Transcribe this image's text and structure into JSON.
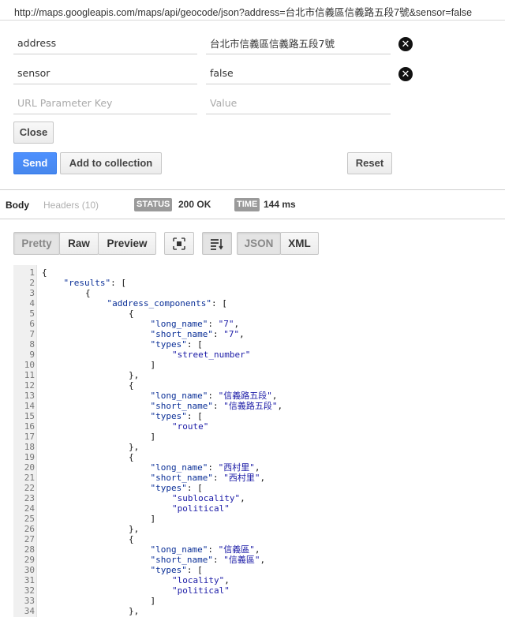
{
  "url": "http://maps.googleapis.com/maps/api/geocode/json?address=台北市信義區信義路五段7號&sensor=false",
  "params": [
    {
      "key": "address",
      "value": "台北市信義區信義路五段7號"
    },
    {
      "key": "sensor",
      "value": "false"
    }
  ],
  "new_param": {
    "key_placeholder": "URL Parameter Key",
    "value_placeholder": "Value"
  },
  "buttons": {
    "close": "Close",
    "send": "Send",
    "add_collection": "Add to collection",
    "reset": "Reset"
  },
  "response_tabs": {
    "body": "Body",
    "headers": "Headers (10)"
  },
  "status": {
    "label": "STATUS",
    "value": "200 OK"
  },
  "time": {
    "label": "TIME",
    "value": "144 ms"
  },
  "view_modes": {
    "pretty": "Pretty",
    "raw": "Raw",
    "preview": "Preview",
    "json": "JSON",
    "xml": "XML"
  },
  "icons": {
    "delete": "remove-circle-icon",
    "fullscreen": "expand-icon",
    "wrap": "wrap-lines-icon"
  },
  "colors": {
    "send_button": "#4d90fe",
    "badge": "#9a9a9a",
    "json_key": "#0a2f97",
    "json_string": "#1a1aa6"
  },
  "code_lines": [
    {
      "n": "1",
      "indent": 0,
      "parts": [
        [
          "p",
          "{"
        ]
      ]
    },
    {
      "n": "2",
      "indent": 1,
      "parts": [
        [
          "k",
          "\"results\""
        ],
        [
          "p",
          ": ["
        ]
      ]
    },
    {
      "n": "3",
      "indent": 2,
      "parts": [
        [
          "p",
          "{"
        ]
      ]
    },
    {
      "n": "4",
      "indent": 3,
      "parts": [
        [
          "k",
          "\"address_components\""
        ],
        [
          "p",
          ": ["
        ]
      ]
    },
    {
      "n": "5",
      "indent": 4,
      "parts": [
        [
          "p",
          "{"
        ]
      ]
    },
    {
      "n": "6",
      "indent": 5,
      "parts": [
        [
          "k",
          "\"long_name\""
        ],
        [
          "p",
          ": "
        ],
        [
          "s",
          "\"7\""
        ],
        [
          "p",
          ","
        ]
      ]
    },
    {
      "n": "7",
      "indent": 5,
      "parts": [
        [
          "k",
          "\"short_name\""
        ],
        [
          "p",
          ": "
        ],
        [
          "s",
          "\"7\""
        ],
        [
          "p",
          ","
        ]
      ]
    },
    {
      "n": "8",
      "indent": 5,
      "parts": [
        [
          "k",
          "\"types\""
        ],
        [
          "p",
          ": ["
        ]
      ]
    },
    {
      "n": "9",
      "indent": 6,
      "parts": [
        [
          "s",
          "\"street_number\""
        ]
      ]
    },
    {
      "n": "10",
      "indent": 5,
      "parts": [
        [
          "p",
          "]"
        ]
      ]
    },
    {
      "n": "11",
      "indent": 4,
      "parts": [
        [
          "p",
          "},"
        ]
      ]
    },
    {
      "n": "12",
      "indent": 4,
      "parts": [
        [
          "p",
          "{"
        ]
      ]
    },
    {
      "n": "13",
      "indent": 5,
      "parts": [
        [
          "k",
          "\"long_name\""
        ],
        [
          "p",
          ": "
        ],
        [
          "s",
          "\"信義路五段\""
        ],
        [
          "p",
          ","
        ]
      ]
    },
    {
      "n": "14",
      "indent": 5,
      "parts": [
        [
          "k",
          "\"short_name\""
        ],
        [
          "p",
          ": "
        ],
        [
          "s",
          "\"信義路五段\""
        ],
        [
          "p",
          ","
        ]
      ]
    },
    {
      "n": "15",
      "indent": 5,
      "parts": [
        [
          "k",
          "\"types\""
        ],
        [
          "p",
          ": ["
        ]
      ]
    },
    {
      "n": "16",
      "indent": 6,
      "parts": [
        [
          "s",
          "\"route\""
        ]
      ]
    },
    {
      "n": "17",
      "indent": 5,
      "parts": [
        [
          "p",
          "]"
        ]
      ]
    },
    {
      "n": "18",
      "indent": 4,
      "parts": [
        [
          "p",
          "},"
        ]
      ]
    },
    {
      "n": "19",
      "indent": 4,
      "parts": [
        [
          "p",
          "{"
        ]
      ]
    },
    {
      "n": "20",
      "indent": 5,
      "parts": [
        [
          "k",
          "\"long_name\""
        ],
        [
          "p",
          ": "
        ],
        [
          "s",
          "\"西村里\""
        ],
        [
          "p",
          ","
        ]
      ]
    },
    {
      "n": "21",
      "indent": 5,
      "parts": [
        [
          "k",
          "\"short_name\""
        ],
        [
          "p",
          ": "
        ],
        [
          "s",
          "\"西村里\""
        ],
        [
          "p",
          ","
        ]
      ]
    },
    {
      "n": "22",
      "indent": 5,
      "parts": [
        [
          "k",
          "\"types\""
        ],
        [
          "p",
          ": ["
        ]
      ]
    },
    {
      "n": "23",
      "indent": 6,
      "parts": [
        [
          "s",
          "\"sublocality\""
        ],
        [
          "p",
          ","
        ]
      ]
    },
    {
      "n": "24",
      "indent": 6,
      "parts": [
        [
          "s",
          "\"political\""
        ]
      ]
    },
    {
      "n": "25",
      "indent": 5,
      "parts": [
        [
          "p",
          "]"
        ]
      ]
    },
    {
      "n": "26",
      "indent": 4,
      "parts": [
        [
          "p",
          "},"
        ]
      ]
    },
    {
      "n": "27",
      "indent": 4,
      "parts": [
        [
          "p",
          "{"
        ]
      ]
    },
    {
      "n": "28",
      "indent": 5,
      "parts": [
        [
          "k",
          "\"long_name\""
        ],
        [
          "p",
          ": "
        ],
        [
          "s",
          "\"信義區\""
        ],
        [
          "p",
          ","
        ]
      ]
    },
    {
      "n": "29",
      "indent": 5,
      "parts": [
        [
          "k",
          "\"short_name\""
        ],
        [
          "p",
          ": "
        ],
        [
          "s",
          "\"信義區\""
        ],
        [
          "p",
          ","
        ]
      ]
    },
    {
      "n": "30",
      "indent": 5,
      "parts": [
        [
          "k",
          "\"types\""
        ],
        [
          "p",
          ": ["
        ]
      ]
    },
    {
      "n": "31",
      "indent": 6,
      "parts": [
        [
          "s",
          "\"locality\""
        ],
        [
          "p",
          ","
        ]
      ]
    },
    {
      "n": "32",
      "indent": 6,
      "parts": [
        [
          "s",
          "\"political\""
        ]
      ]
    },
    {
      "n": "33",
      "indent": 5,
      "parts": [
        [
          "p",
          "]"
        ]
      ]
    },
    {
      "n": "34",
      "indent": 4,
      "parts": [
        [
          "p",
          "},"
        ]
      ]
    }
  ]
}
